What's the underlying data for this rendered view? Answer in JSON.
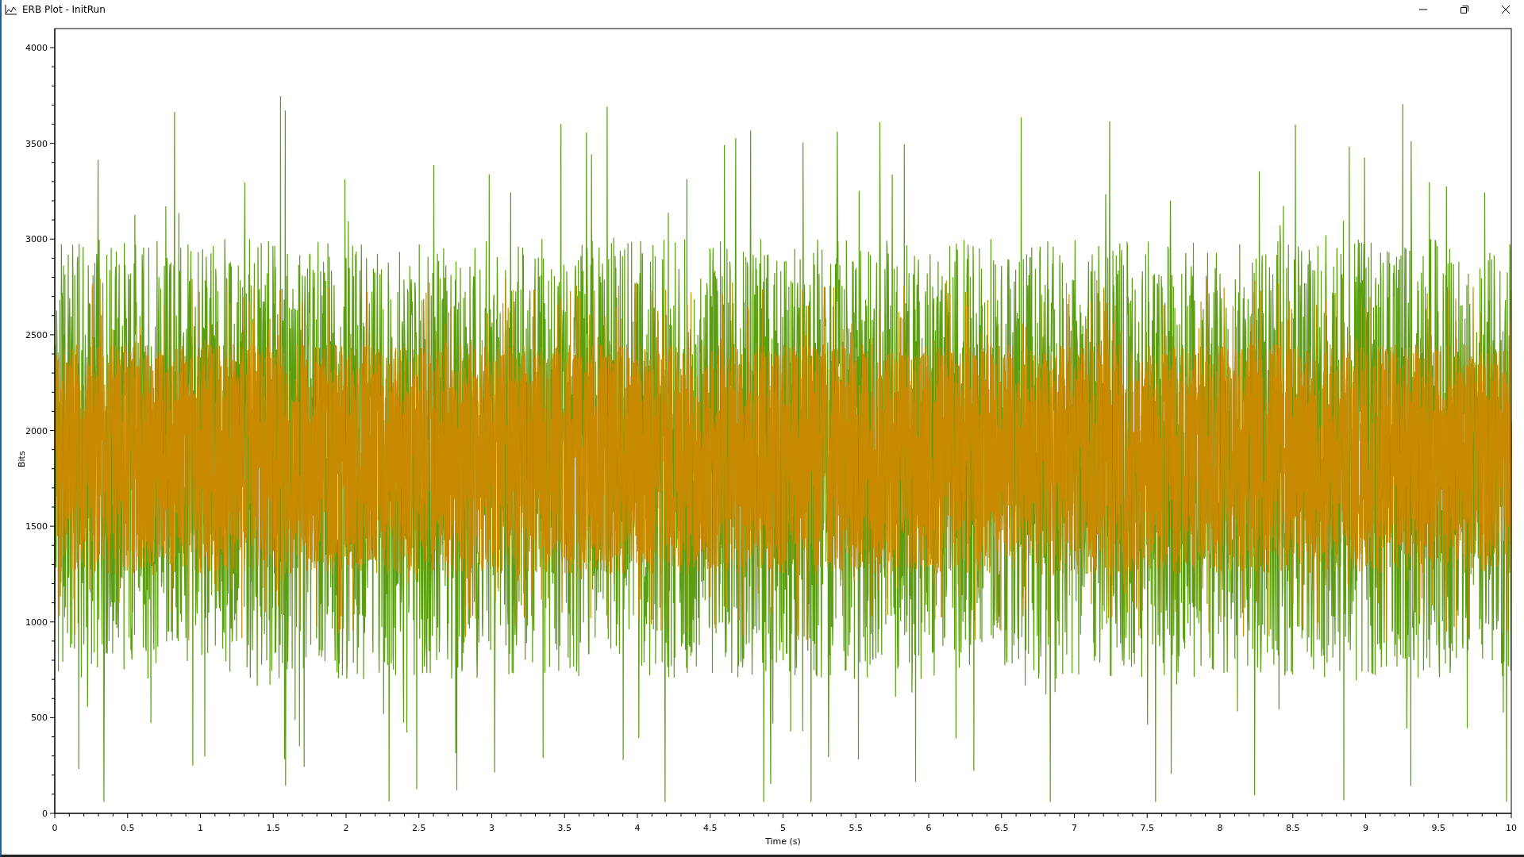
{
  "window": {
    "title": "ERB Plot - InitRun"
  },
  "plot": {
    "xlabel": "Time (s)",
    "ylabel": "Bits",
    "xticks": [
      "0",
      "0.5",
      "1",
      "1.5",
      "2",
      "2.5",
      "3",
      "3.5",
      "4",
      "4.5",
      "5",
      "5.5",
      "6",
      "6.5",
      "7",
      "7.5",
      "8",
      "8.5",
      "9",
      "9.5",
      "10"
    ],
    "yticks": [
      "4000",
      "3500",
      "3000",
      "2500",
      "2000",
      "1500",
      "1000",
      "500",
      "0"
    ],
    "traces": [
      {
        "color": "#5a9e12"
      },
      {
        "color": "#c88a00"
      }
    ]
  }
}
